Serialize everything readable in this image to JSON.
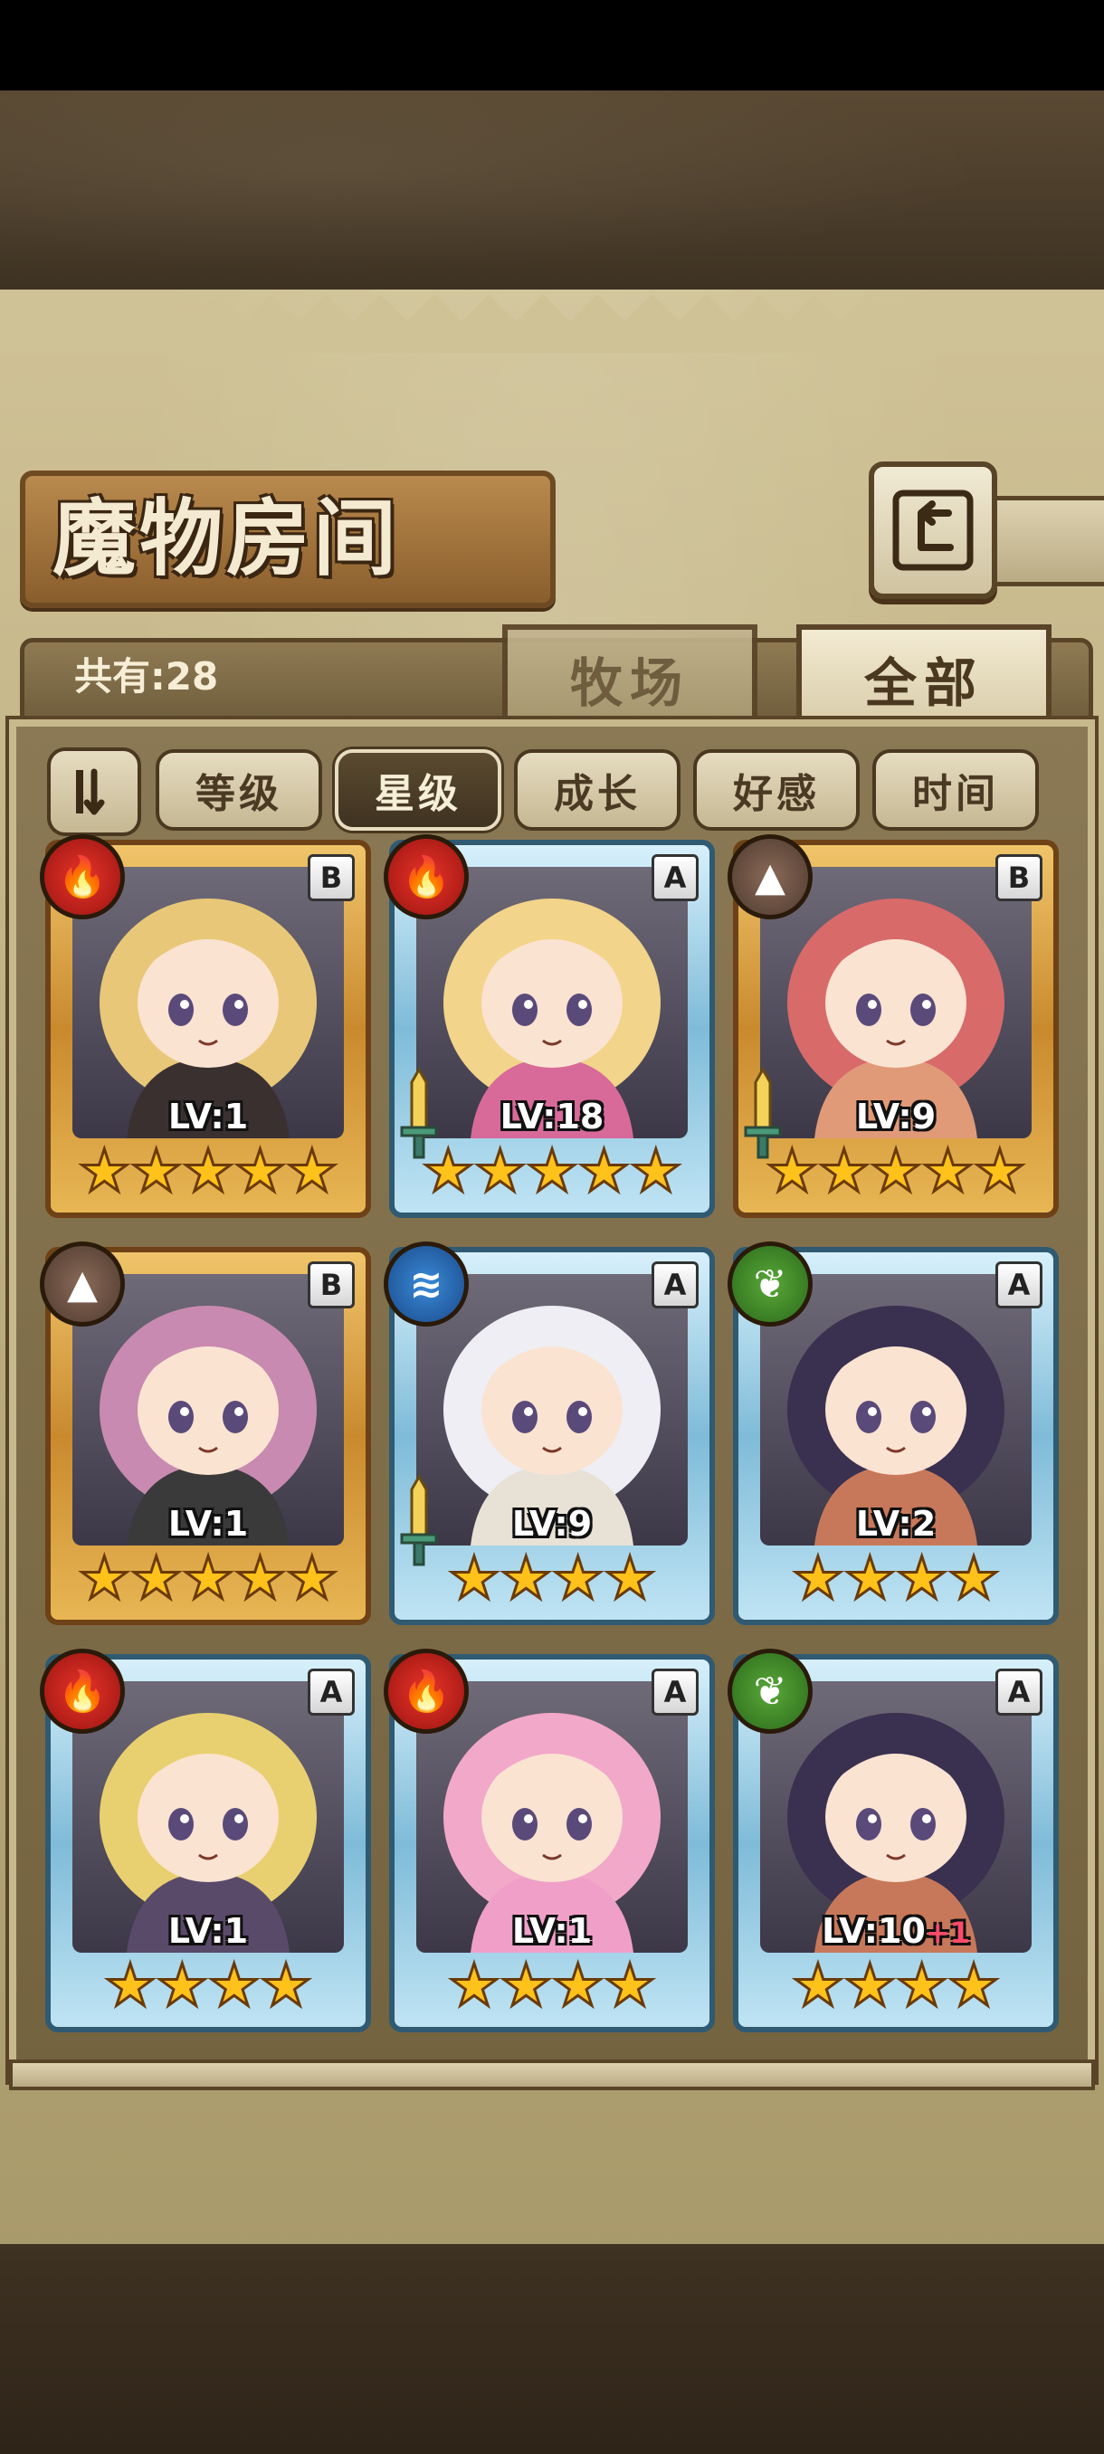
{
  "title": "魔物房间",
  "count_label": "共有:28",
  "tabs": [
    {
      "label": "牧场",
      "active": false
    },
    {
      "label": "全部",
      "active": true
    }
  ],
  "sort_toggle_icon": "sort-toggle-icon",
  "filters": [
    {
      "label": "等级",
      "active": false
    },
    {
      "label": "星级",
      "active": true
    },
    {
      "label": "成长",
      "active": false
    },
    {
      "label": "好感",
      "active": false
    },
    {
      "label": "时间",
      "active": false
    }
  ],
  "monsters": [
    {
      "level": "LV:1",
      "level_bonus": "",
      "stars": 5,
      "element": "fire",
      "grade": "B",
      "frame": "gold",
      "weapon": false
    },
    {
      "level": "LV:18",
      "level_bonus": "",
      "stars": 5,
      "element": "fire",
      "grade": "A",
      "frame": "blue",
      "weapon": true
    },
    {
      "level": "LV:9",
      "level_bonus": "",
      "stars": 5,
      "element": "earth",
      "grade": "B",
      "frame": "gold",
      "weapon": true
    },
    {
      "level": "LV:1",
      "level_bonus": "",
      "stars": 5,
      "element": "earth",
      "grade": "B",
      "frame": "gold",
      "weapon": false
    },
    {
      "level": "LV:9",
      "level_bonus": "",
      "stars": 4,
      "element": "water",
      "grade": "A",
      "frame": "blue",
      "weapon": true
    },
    {
      "level": "LV:2",
      "level_bonus": "",
      "stars": 4,
      "element": "wood",
      "grade": "A",
      "frame": "blue",
      "weapon": false
    },
    {
      "level": "LV:1",
      "level_bonus": "",
      "stars": 4,
      "element": "fire",
      "grade": "A",
      "frame": "blue",
      "weapon": false
    },
    {
      "level": "LV:1",
      "level_bonus": "",
      "stars": 4,
      "element": "fire",
      "grade": "A",
      "frame": "blue",
      "weapon": false
    },
    {
      "level": "LV:10",
      "level_bonus": "+1",
      "stars": 4,
      "element": "wood",
      "grade": "A",
      "frame": "blue",
      "weapon": false
    }
  ],
  "colors": {
    "parchment": "#b8a878",
    "panel": "#74633f",
    "gold_frame": "#c98a2e",
    "blue_frame": "#7fbbd8",
    "star": "#ffc21a",
    "fire": "#e8342a",
    "water": "#3a8ad8",
    "wood": "#5aa83a",
    "earth": "#8a6a58"
  }
}
